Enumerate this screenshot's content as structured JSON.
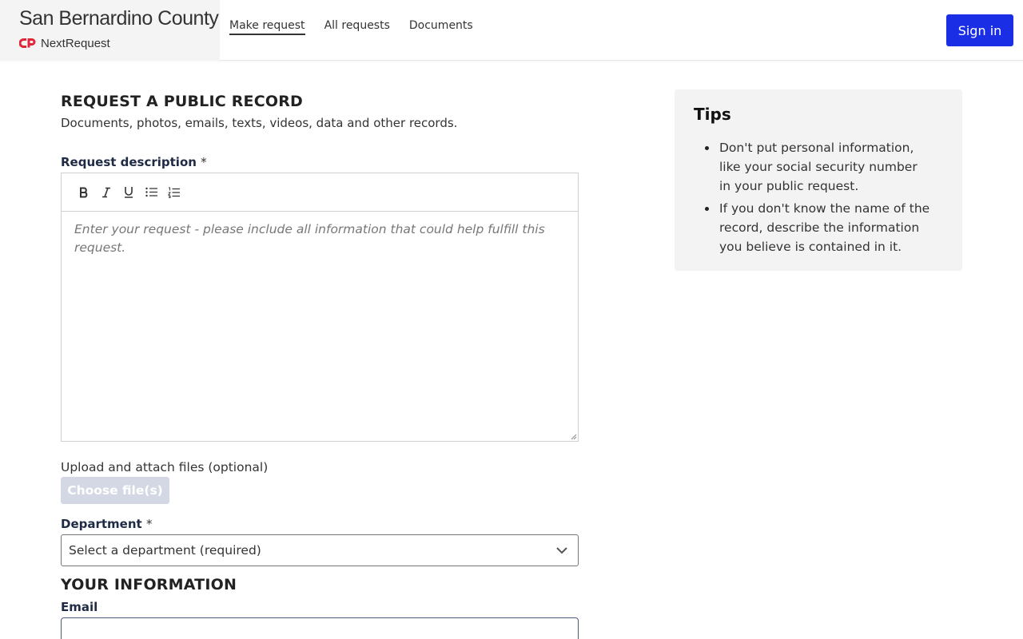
{
  "header": {
    "org_name": "San Bernardino County",
    "product_name": "NextRequest",
    "logo_icon": "nextrequest-logo-icon",
    "nav": [
      {
        "label": "Make request",
        "active": true
      },
      {
        "label": "All requests",
        "active": false
      },
      {
        "label": "Documents",
        "active": false
      }
    ],
    "sign_in_label": "Sign in",
    "accent_color": "#1a2ee6"
  },
  "form": {
    "heading": "REQUEST A PUBLIC RECORD",
    "subtitle": "Documents, photos, emails, texts, videos, data and other records.",
    "description_label": "Request description",
    "required_marker": "*",
    "toolbar": [
      {
        "icon": "bold-icon"
      },
      {
        "icon": "italic-icon"
      },
      {
        "icon": "underline-icon"
      },
      {
        "icon": "bullet-list-icon"
      },
      {
        "icon": "numbered-list-icon"
      }
    ],
    "description_placeholder": "Enter your request - please include all information that could help fulfill this request.",
    "upload_label": "Upload and attach files (optional)",
    "choose_files_label": "Choose file(s)",
    "department_label": "Department",
    "department_selected": "Select a department (required)",
    "your_info_heading": "YOUR INFORMATION",
    "email_label": "Email",
    "email_value": ""
  },
  "tips": {
    "title": "Tips",
    "items": [
      "Don't put personal information, like your social security number in your public request.",
      "If you don't know the name of the record, describe the information you believe is contained in it."
    ]
  }
}
